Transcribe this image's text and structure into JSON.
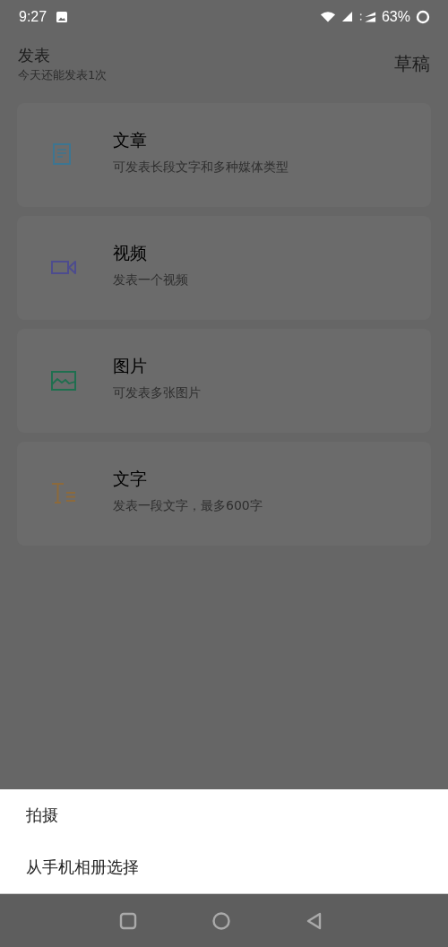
{
  "status_bar": {
    "time": "9:27",
    "battery": "63%"
  },
  "header": {
    "title": "发表",
    "subtitle": "今天还能发表1次",
    "action": "草稿"
  },
  "options": [
    {
      "kind": "article",
      "title": "文章",
      "description": "可发表长段文字和多种媒体类型"
    },
    {
      "kind": "video",
      "title": "视频",
      "description": "发表一个视频"
    },
    {
      "kind": "image",
      "title": "图片",
      "description": "可发表多张图片"
    },
    {
      "kind": "text",
      "title": "文字",
      "description": "发表一段文字，最多600字"
    }
  ],
  "sheet": {
    "items": [
      "拍摄",
      "从手机相册选择"
    ]
  }
}
